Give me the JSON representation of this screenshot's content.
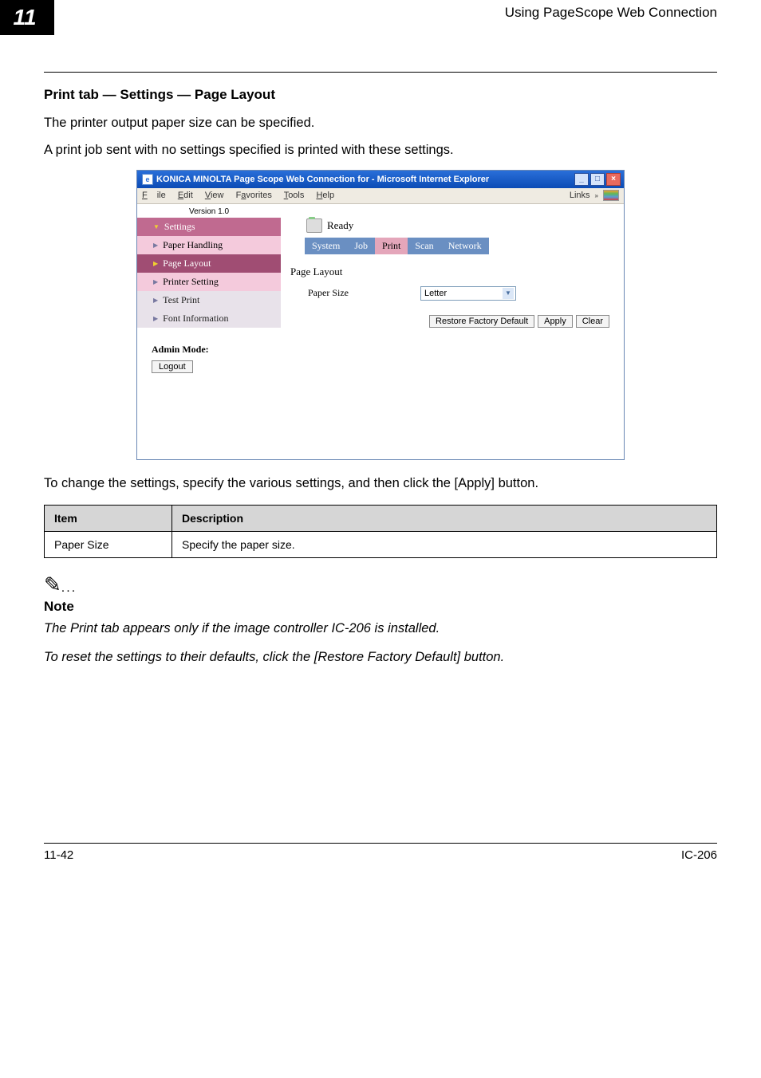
{
  "header": {
    "chapter_number": "11",
    "chapter_title": "Using PageScope Web Connection"
  },
  "section": {
    "title": "Print tab — Settings — Page Layout",
    "para1": "The printer output paper size can be specified.",
    "para2": "A print job sent with no settings specified is printed with these settings.",
    "after_shot": "To change the settings, specify the various settings, and then click the [Apply] button."
  },
  "screenshot": {
    "window_title": "KONICA MINOLTA Page Scope Web Connection for       - Microsoft Internet Explorer",
    "menu": {
      "file": "File",
      "edit": "Edit",
      "view": "View",
      "favorites": "Favorites",
      "tools": "Tools",
      "help": "Help",
      "links": "Links"
    },
    "status": "Ready",
    "tabs": {
      "system": "System",
      "job": "Job",
      "print": "Print",
      "scan": "Scan",
      "network": "Network"
    },
    "version": "Version 1.0",
    "sidebar": {
      "settings": "Settings",
      "paper_handling": "Paper Handling",
      "page_layout": "Page Layout",
      "printer_setting": "Printer Setting",
      "test_print": "Test Print",
      "font_info": "Font Information"
    },
    "admin_label": "Admin Mode:",
    "logout": "Logout",
    "content": {
      "title": "Page Layout",
      "field_label": "Paper Size",
      "field_value": "Letter"
    },
    "buttons": {
      "restore": "Restore Factory Default",
      "apply": "Apply",
      "clear": "Clear"
    }
  },
  "table": {
    "head_item": "Item",
    "head_desc": "Description",
    "row1_item": "Paper Size",
    "row1_desc": "Specify the paper size."
  },
  "note": {
    "label": "Note",
    "p1": "The Print tab appears only if the image controller IC-206 is installed.",
    "p2": "To reset the settings to their defaults, click the [Restore Factory Default] button."
  },
  "footer": {
    "left": "11-42",
    "right": "IC-206"
  }
}
